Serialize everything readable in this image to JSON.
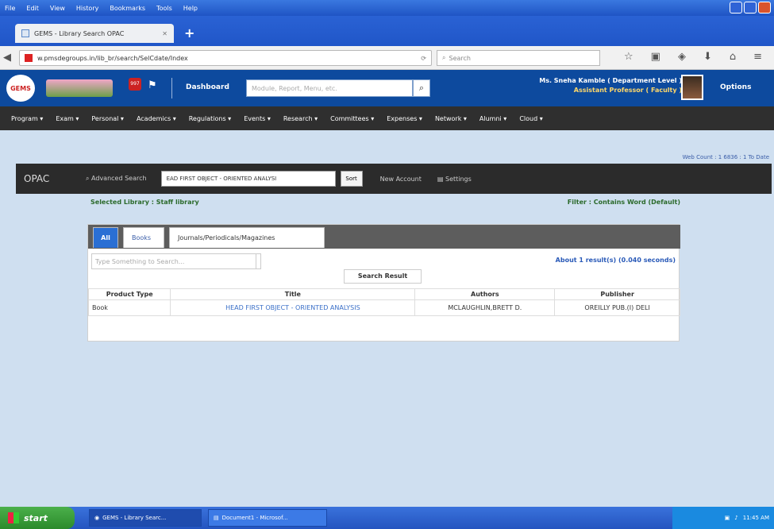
{
  "browser": {
    "menu": [
      "File",
      "Edit",
      "View",
      "History",
      "Bookmarks",
      "Tools",
      "Help"
    ],
    "tab_title": "GEMS - Library Search OPAC",
    "url": "w.pmsdegroups.in/lib_br/search/SelCdate/Index",
    "search_placeholder": "Search"
  },
  "header": {
    "logo_text": "GEMS",
    "notif_badge": "997",
    "dashboard_label": "Dashboard",
    "search_placeholder": "Module, Report, Menu, etc.",
    "user_name": "Ms. Sneha Kamble ( Department Level )",
    "user_role": "Assistant Professor ( Faculty )",
    "options_label": "Options"
  },
  "mainmenu": [
    "Program",
    "Exam",
    "Personal",
    "Academics",
    "Regulations",
    "Events",
    "Research",
    "Committees",
    "Expenses",
    "Network",
    "Alumni",
    "Cloud"
  ],
  "opac": {
    "top_count": "Web Count : 1 6836 : 1 To Date",
    "title": "OPAC",
    "advanced_search": "Advanced Search",
    "select_value": "EAD FIRST OBJECT - ORIENTED ANALYSI",
    "sort_label": "Sort",
    "new_account": "New Account",
    "settings": "Settings",
    "selected_library": "Selected Library : Staff library",
    "filter_text": "Filter : Contains Word (Default)"
  },
  "results": {
    "tabs": [
      "All",
      "Books",
      "Journals/Periodicals/Magazines"
    ],
    "search_placeholder": "Type Something to Search...",
    "about": "About 1 result(s) (0.040 seconds)",
    "section_label": "Search Result",
    "columns": [
      "Product Type",
      "Title",
      "Authors",
      "Publisher"
    ],
    "rows": [
      {
        "type": "Book",
        "title": "HEAD FIRST OBJECT - ORIENTED ANALYSIS",
        "authors": "MCLAUGHLIN,BRETT D.",
        "publisher": "OREILLY PUB.(I) DELI"
      }
    ]
  },
  "taskbar": {
    "start": "start",
    "tasks": [
      "GEMS - Library Searc...",
      "Document1 - Microsof..."
    ],
    "clock": "11:45 AM"
  }
}
